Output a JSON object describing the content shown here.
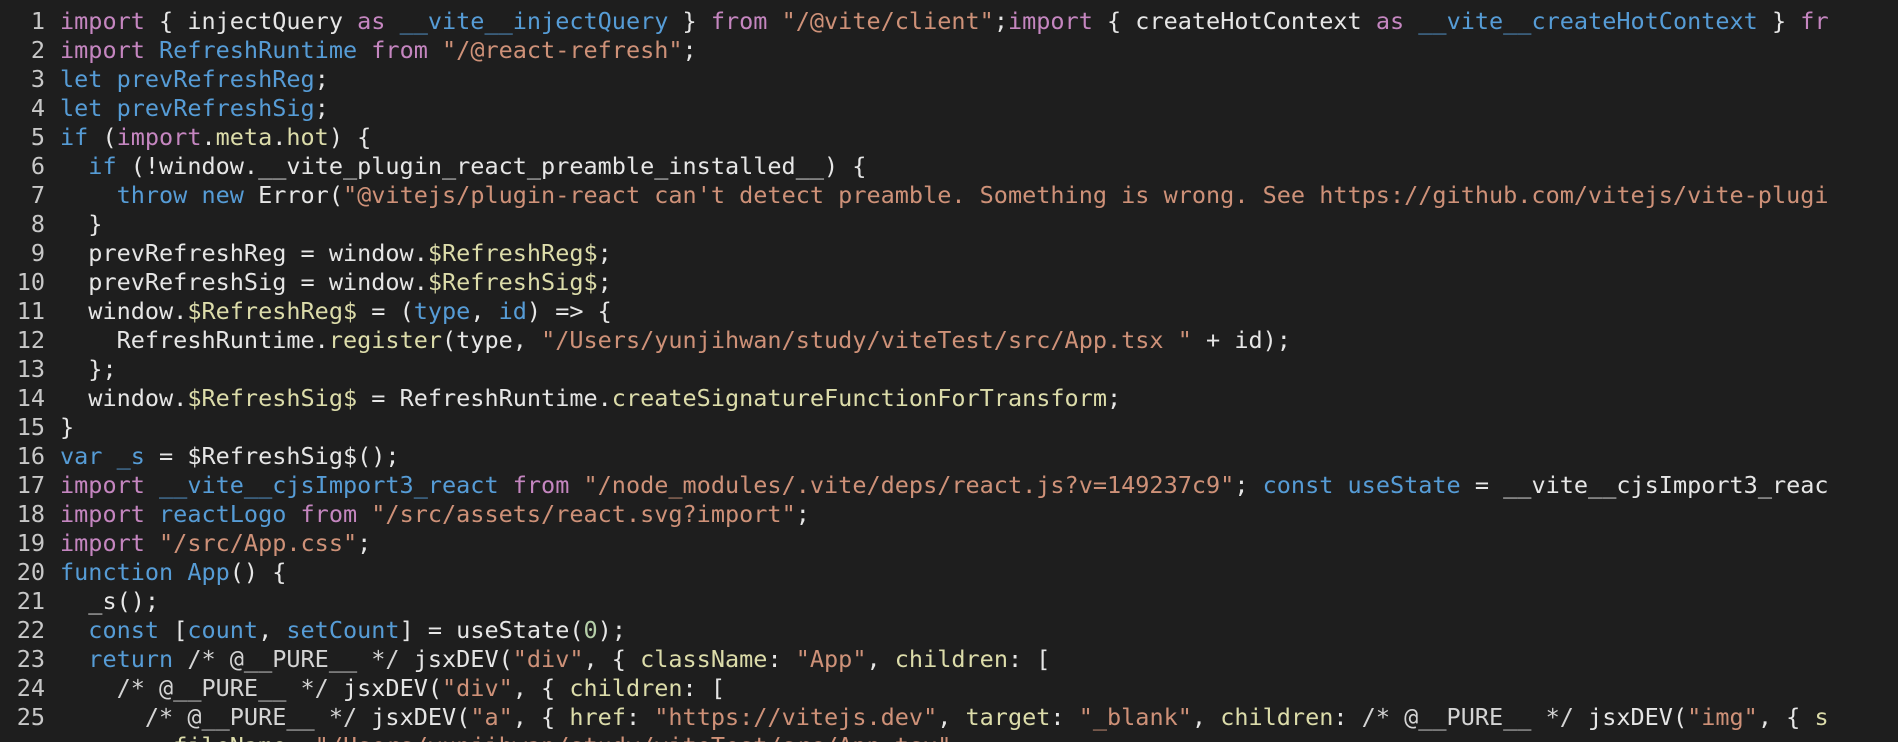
{
  "editor": {
    "language": "javascript",
    "lines": [
      {
        "n": "1",
        "t": [
          [
            "kw",
            "import"
          ],
          [
            "pl",
            " { injectQuery "
          ],
          [
            "kw",
            "as"
          ],
          [
            "id",
            " __vite__injectQuery"
          ],
          [
            "pl",
            " } "
          ],
          [
            "kw",
            "from"
          ],
          [
            "st",
            " \"/@vite/client\""
          ],
          [
            "pl",
            ";"
          ],
          [
            "kw",
            "import"
          ],
          [
            "pl",
            " { createHotContext "
          ],
          [
            "kw",
            "as"
          ],
          [
            "id",
            " __vite__createHotContext"
          ],
          [
            "pl",
            " } "
          ],
          [
            "kw",
            "fr"
          ]
        ]
      },
      {
        "n": "2",
        "t": [
          [
            "kw",
            "import"
          ],
          [
            "id",
            " RefreshRuntime"
          ],
          [
            "kw",
            " from"
          ],
          [
            "st",
            " \"/@react-refresh\""
          ],
          [
            "pl",
            ";"
          ]
        ]
      },
      {
        "n": "3",
        "t": [
          [
            "dk",
            "let"
          ],
          [
            "id",
            " prevRefreshReg"
          ],
          [
            "pl",
            ";"
          ]
        ]
      },
      {
        "n": "4",
        "t": [
          [
            "dk",
            "let"
          ],
          [
            "id",
            " prevRefreshSig"
          ],
          [
            "pl",
            ";"
          ]
        ]
      },
      {
        "n": "5",
        "t": [
          [
            "dk",
            "if"
          ],
          [
            "pl",
            " ("
          ],
          [
            "kw",
            "import"
          ],
          [
            "pl",
            "."
          ],
          [
            "fn",
            "meta"
          ],
          [
            "pl",
            "."
          ],
          [
            "fn",
            "hot"
          ],
          [
            "pl",
            ") {"
          ]
        ]
      },
      {
        "n": "6",
        "t": [
          [
            "pl",
            "  "
          ],
          [
            "dk",
            "if"
          ],
          [
            "pl",
            " (!window.__vite_plugin_react_preamble_installed__) {"
          ]
        ]
      },
      {
        "n": "7",
        "t": [
          [
            "pl",
            "    "
          ],
          [
            "dk",
            "throw"
          ],
          [
            "dk",
            " new"
          ],
          [
            "pl",
            " Error("
          ],
          [
            "st",
            "\"@vitejs/plugin-react can't detect preamble. Something is wrong. See https://github.com/vitejs/vite-plugi"
          ]
        ]
      },
      {
        "n": "8",
        "t": [
          [
            "pl",
            "  }"
          ]
        ]
      },
      {
        "n": "9",
        "t": [
          [
            "pl",
            "  prevRefreshReg = window."
          ],
          [
            "fn",
            "$RefreshReg$"
          ],
          [
            "pl",
            ";"
          ]
        ]
      },
      {
        "n": "10",
        "t": [
          [
            "pl",
            "  prevRefreshSig = window."
          ],
          [
            "fn",
            "$RefreshSig$"
          ],
          [
            "pl",
            ";"
          ]
        ]
      },
      {
        "n": "11",
        "t": [
          [
            "pl",
            "  window."
          ],
          [
            "fn",
            "$RefreshReg$"
          ],
          [
            "pl",
            " = ("
          ],
          [
            "id",
            "type"
          ],
          [
            "pl",
            ", "
          ],
          [
            "id",
            "id"
          ],
          [
            "pl",
            ") => {"
          ]
        ]
      },
      {
        "n": "12",
        "t": [
          [
            "pl",
            "    RefreshRuntime."
          ],
          [
            "fn",
            "register"
          ],
          [
            "pl",
            "(type, "
          ],
          [
            "st",
            "\"/Users/yunjihwan/study/viteTest/src/App.tsx \""
          ],
          [
            "pl",
            " + id);"
          ]
        ]
      },
      {
        "n": "13",
        "t": [
          [
            "pl",
            "  };"
          ]
        ]
      },
      {
        "n": "14",
        "t": [
          [
            "pl",
            "  window."
          ],
          [
            "fn",
            "$RefreshSig$"
          ],
          [
            "pl",
            " = RefreshRuntime."
          ],
          [
            "fn",
            "createSignatureFunctionForTransform"
          ],
          [
            "pl",
            ";"
          ]
        ]
      },
      {
        "n": "15",
        "t": [
          [
            "pl",
            "}"
          ]
        ]
      },
      {
        "n": "16",
        "t": [
          [
            "dk",
            "var"
          ],
          [
            "id",
            " _s"
          ],
          [
            "pl",
            " = $RefreshSig$();"
          ]
        ]
      },
      {
        "n": "17",
        "t": [
          [
            "kw",
            "import"
          ],
          [
            "id",
            " __vite__cjsImport3_react"
          ],
          [
            "kw",
            " from"
          ],
          [
            "st",
            " \"/node_modules/.vite/deps/react.js?v=149237c9\""
          ],
          [
            "pl",
            "; "
          ],
          [
            "dk",
            "const"
          ],
          [
            "id",
            " useState"
          ],
          [
            "pl",
            " = __vite__cjsImport3_reac"
          ]
        ]
      },
      {
        "n": "18",
        "t": [
          [
            "kw",
            "import"
          ],
          [
            "id",
            " reactLogo"
          ],
          [
            "kw",
            " from"
          ],
          [
            "st",
            " \"/src/assets/react.svg?import\""
          ],
          [
            "pl",
            ";"
          ]
        ]
      },
      {
        "n": "19",
        "t": [
          [
            "kw",
            "import"
          ],
          [
            "st",
            " \"/src/App.css\""
          ],
          [
            "pl",
            ";"
          ]
        ]
      },
      {
        "n": "20",
        "t": [
          [
            "dk",
            "function"
          ],
          [
            "id",
            " App"
          ],
          [
            "pl",
            "() {"
          ]
        ]
      },
      {
        "n": "21",
        "t": [
          [
            "pl",
            "  _s();"
          ]
        ]
      },
      {
        "n": "22",
        "t": [
          [
            "pl",
            "  "
          ],
          [
            "dk",
            "const"
          ],
          [
            "pl",
            " ["
          ],
          [
            "id",
            "count"
          ],
          [
            "pl",
            ", "
          ],
          [
            "id",
            "setCount"
          ],
          [
            "pl",
            "] = useState("
          ],
          [
            "nm",
            "0"
          ],
          [
            "pl",
            ");"
          ]
        ]
      },
      {
        "n": "23",
        "t": [
          [
            "pl",
            "  "
          ],
          [
            "dk",
            "return"
          ],
          [
            "cm",
            " /* @__PURE__ */"
          ],
          [
            "pl",
            " jsxDEV("
          ],
          [
            "st",
            "\"div\""
          ],
          [
            "pl",
            ", { "
          ],
          [
            "fn",
            "className"
          ],
          [
            "pl",
            ": "
          ],
          [
            "st",
            "\"App\""
          ],
          [
            "pl",
            ", "
          ],
          [
            "fn",
            "children"
          ],
          [
            "pl",
            ": ["
          ]
        ]
      },
      {
        "n": "24",
        "t": [
          [
            "pl",
            "    "
          ],
          [
            "cm",
            "/* @__PURE__ */"
          ],
          [
            "pl",
            " jsxDEV("
          ],
          [
            "st",
            "\"div\""
          ],
          [
            "pl",
            ", { "
          ],
          [
            "fn",
            "children"
          ],
          [
            "pl",
            ": ["
          ]
        ]
      },
      {
        "n": "25",
        "t": [
          [
            "pl",
            "      "
          ],
          [
            "cm",
            "/* @__PURE__ */"
          ],
          [
            "pl",
            " jsxDEV("
          ],
          [
            "st",
            "\"a\""
          ],
          [
            "pl",
            ", { "
          ],
          [
            "fn",
            "href"
          ],
          [
            "pl",
            ": "
          ],
          [
            "st",
            "\"https://vitejs.dev\""
          ],
          [
            "pl",
            ", "
          ],
          [
            "fn",
            "target"
          ],
          [
            "pl",
            ": "
          ],
          [
            "st",
            "\"_blank\""
          ],
          [
            "pl",
            ", "
          ],
          [
            "fn",
            "children"
          ],
          [
            "pl",
            ": "
          ],
          [
            "cm",
            "/* @__PURE__ */"
          ],
          [
            "pl",
            " jsxDEV("
          ],
          [
            "st",
            "\"img\""
          ],
          [
            "pl",
            ", { "
          ],
          [
            "fn",
            "s"
          ]
        ]
      },
      {
        "n": "",
        "t": [
          [
            "pl",
            "        "
          ],
          [
            "fn",
            "fileName"
          ],
          [
            "pl",
            ": "
          ],
          [
            "st",
            "\"/Users/yunjihwan/study/viteTest/src/App.tsx\""
          ]
        ]
      }
    ]
  }
}
